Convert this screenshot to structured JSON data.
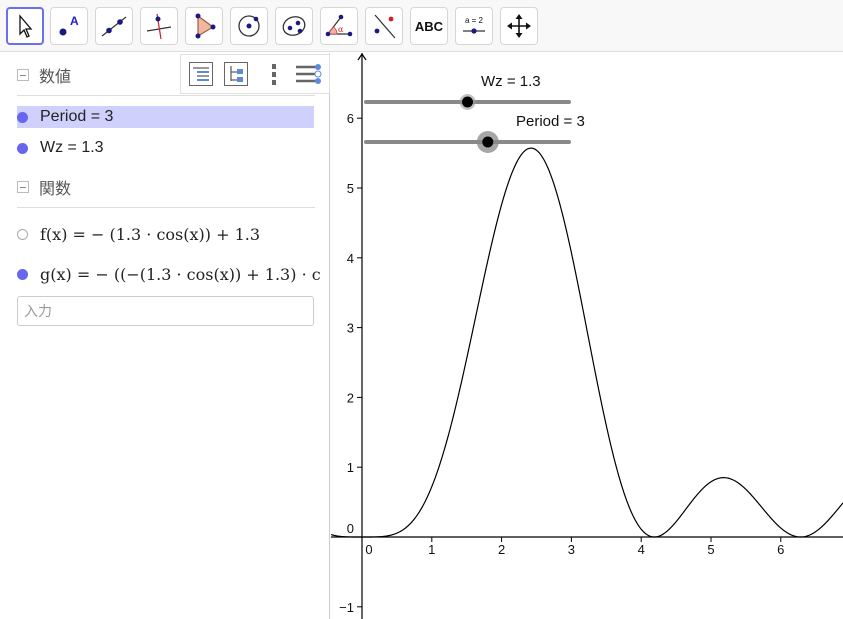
{
  "toolbar": {
    "tools": [
      {
        "name": "move-tool",
        "icon": "cursor-arrow-icon"
      },
      {
        "name": "point-tool",
        "icon": "point-icon",
        "letter": "A"
      },
      {
        "name": "line-tool",
        "icon": "line-through-points-icon"
      },
      {
        "name": "perpendicular-tool",
        "icon": "perpendicular-line-icon"
      },
      {
        "name": "polygon-tool",
        "icon": "polygon-icon"
      },
      {
        "name": "circle-tool",
        "icon": "circle-center-point-icon"
      },
      {
        "name": "ellipse-tool",
        "icon": "ellipse-icon"
      },
      {
        "name": "angle-tool",
        "icon": "angle-icon",
        "letter": "α"
      },
      {
        "name": "reflect-tool",
        "icon": "reflect-about-line-icon"
      },
      {
        "name": "text-tool",
        "icon": "text-icon",
        "text": "ABC"
      },
      {
        "name": "slider-tool",
        "icon": "slider-icon",
        "text": "a = 2"
      },
      {
        "name": "move-graphics-tool",
        "icon": "move-arrows-icon"
      }
    ]
  },
  "algebra": {
    "groups": {
      "numbers": "数値",
      "functions": "関数"
    },
    "numbers": {
      "period": "Period = 3",
      "wz": "Wz = 1.3"
    },
    "functions": {
      "f": "f(x)  =  − (1.3 · cos(x)) + 1.3",
      "g": "g(x)  =  − ((−(1.3 · cos(x)) + 1.3) · c"
    },
    "input_placeholder": "入力"
  },
  "graphics": {
    "sliders": [
      {
        "label": "Wz = 1.3",
        "value": 1.3,
        "min": 0,
        "max": 2.6
      },
      {
        "label": "Period = 3",
        "value": 3,
        "min": 0,
        "max": 5
      }
    ],
    "x_ticks": [
      "0",
      "1",
      "2",
      "3",
      "4",
      "5",
      "6"
    ],
    "y_ticks": [
      "−1",
      "0",
      "1",
      "2",
      "3",
      "4",
      "5",
      "6"
    ],
    "axis_color": "#000000",
    "curve_color": "#000000",
    "accent": "#6666ee"
  }
}
